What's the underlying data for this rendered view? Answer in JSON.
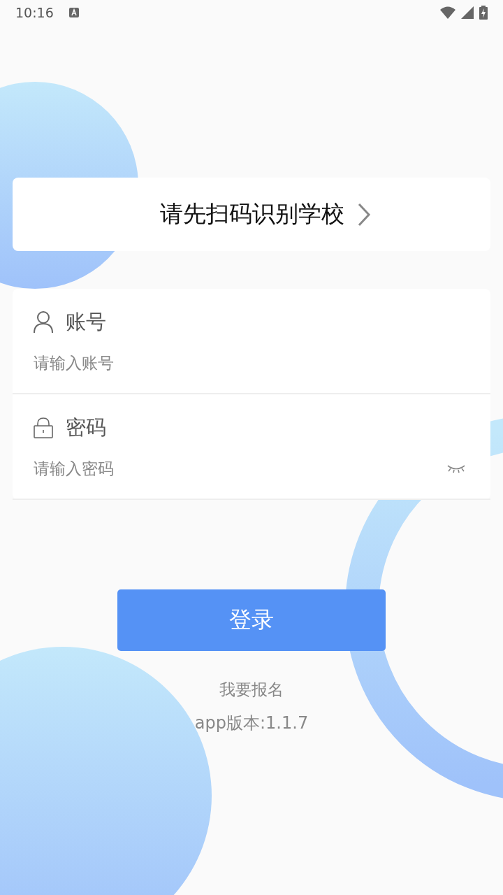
{
  "status_bar": {
    "time": "10:16"
  },
  "school_selector": {
    "label": "请先扫码识别学校"
  },
  "fields": [
    {
      "kind": "account",
      "label": "账号",
      "placeholder": "请输入账号"
    },
    {
      "kind": "password",
      "label": "密码",
      "placeholder": "请输入密码",
      "password_visible": false
    }
  ],
  "login_button": {
    "label": "登录"
  },
  "signup_link": {
    "label": "我要报名"
  },
  "version": "app版本:1.1.7"
}
